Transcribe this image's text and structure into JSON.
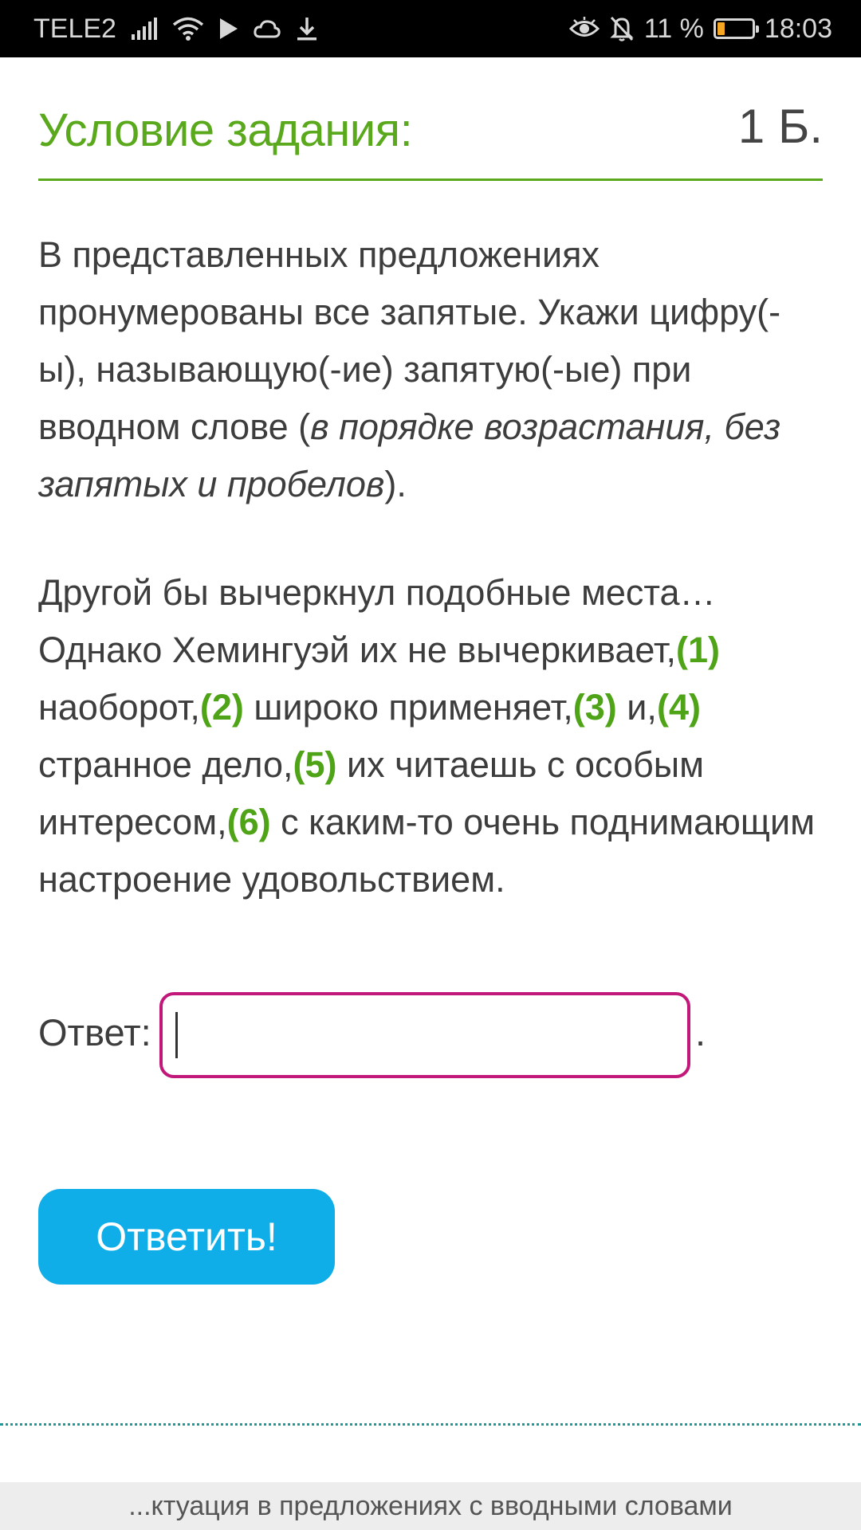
{
  "status_bar": {
    "carrier": "TELE2",
    "battery_percent": "11 %",
    "battery_level": 0.11,
    "time": "18:03",
    "icons": [
      "signal-icon",
      "wifi-icon",
      "play-icon",
      "cloud-icon",
      "download-icon",
      "eye-icon",
      "bell-off-icon",
      "battery-icon"
    ]
  },
  "task": {
    "title": "Условие задания:",
    "points": "1 Б."
  },
  "instruction": {
    "text": "В представленных предложениях пронумерованы все запятые. Укажи цифру(-ы), называющую(-ие) запятую(-ые) при вводном слове (",
    "italic": "в порядке возрастания, без запятых и пробелов",
    "tail": ")."
  },
  "passage": {
    "segments": [
      "Другой бы вычеркнул подобные места… Однако Хемингуэй их не вычеркивает,",
      "наоборот,",
      " широко применяет,",
      " и,",
      "странное дело,",
      " их читаешь с особым интересом,",
      " с каким-то очень поднимающим настроение удовольствием."
    ],
    "numbers": [
      "(1)",
      "(2)",
      "(3)",
      "(4)",
      "(5)",
      "(6)"
    ]
  },
  "answer": {
    "label": "Ответ:",
    "value": "",
    "placeholder": "",
    "suffix": "."
  },
  "submit": {
    "label": "Ответить!"
  },
  "footer": {
    "text": "...ктуация в предложениях с вводными словами"
  },
  "colors": {
    "accent_green": "#5aa91d",
    "number_green": "#4ea317",
    "input_border": "#c2187a",
    "button_blue": "#10aee8"
  }
}
